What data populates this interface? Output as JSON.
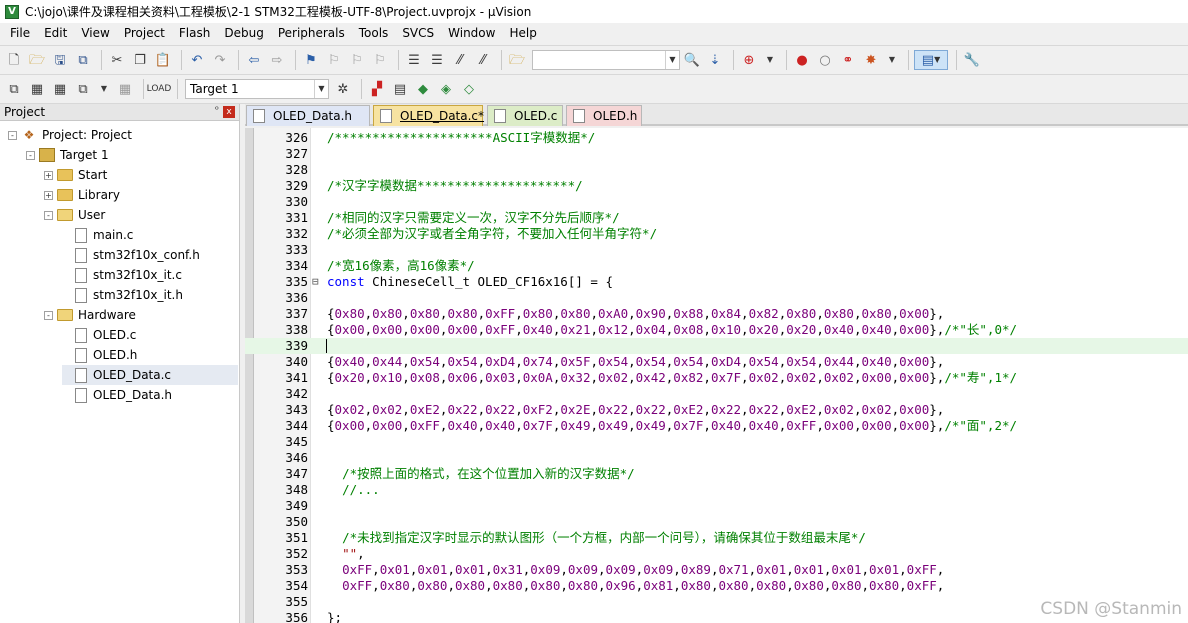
{
  "window": {
    "title": "C:\\jojo\\课件及课程相关资料\\工程模板\\2-1 STM32工程模板-UTF-8\\Project.uvprojx - µVision",
    "app_icon": "V"
  },
  "menu": [
    "File",
    "Edit",
    "View",
    "Project",
    "Flash",
    "Debug",
    "Peripherals",
    "Tools",
    "SVCS",
    "Window",
    "Help"
  ],
  "toolbar2": {
    "target": "Target 1"
  },
  "project_panel": {
    "title": "Project",
    "pin": "ᵒ",
    "close": "x",
    "tree": [
      {
        "label": "Project: Project",
        "level": 0,
        "kind": "project",
        "exp": "-"
      },
      {
        "label": "Target 1",
        "level": 1,
        "kind": "target",
        "exp": "-"
      },
      {
        "label": "Start",
        "level": 2,
        "kind": "folder",
        "exp": "+"
      },
      {
        "label": "Library",
        "level": 2,
        "kind": "folder",
        "exp": "+"
      },
      {
        "label": "User",
        "level": 2,
        "kind": "folder-open",
        "exp": "-"
      },
      {
        "label": "main.c",
        "level": 3,
        "kind": "file"
      },
      {
        "label": "stm32f10x_conf.h",
        "level": 3,
        "kind": "file"
      },
      {
        "label": "stm32f10x_it.c",
        "level": 3,
        "kind": "file"
      },
      {
        "label": "stm32f10x_it.h",
        "level": 3,
        "kind": "file"
      },
      {
        "label": "Hardware",
        "level": 2,
        "kind": "folder-open",
        "exp": "-"
      },
      {
        "label": "OLED.c",
        "level": 3,
        "kind": "file"
      },
      {
        "label": "OLED.h",
        "level": 3,
        "kind": "file"
      },
      {
        "label": "OLED_Data.c",
        "level": 3,
        "kind": "file",
        "selected": true
      },
      {
        "label": "OLED_Data.h",
        "level": 3,
        "kind": "file"
      }
    ]
  },
  "tabs": [
    {
      "label": "OLED_Data.h"
    },
    {
      "label": "OLED_Data.c*"
    },
    {
      "label": "OLED.c"
    },
    {
      "label": "OLED.h"
    }
  ],
  "code": [
    {
      "n": "326",
      "segs": [
        [
          "cmt",
          "/*********************ASCII字模数据*/"
        ]
      ]
    },
    {
      "n": "327",
      "segs": []
    },
    {
      "n": "328",
      "segs": []
    },
    {
      "n": "329",
      "segs": [
        [
          "cmt",
          "/*汉字字模数据*********************/"
        ]
      ]
    },
    {
      "n": "330",
      "segs": []
    },
    {
      "n": "331",
      "segs": [
        [
          "cmt",
          "/*相同的汉字只需要定义一次，汉字不分先后顺序*/"
        ]
      ]
    },
    {
      "n": "332",
      "segs": [
        [
          "cmt",
          "/*必须全部为汉字或者全角字符，不要加入任何半角字符*/"
        ]
      ]
    },
    {
      "n": "333",
      "segs": []
    },
    {
      "n": "334",
      "segs": [
        [
          "cmt",
          "/*宽16像素，高16像素*/"
        ]
      ]
    },
    {
      "n": "335",
      "fold": "⊟",
      "segs": [
        [
          "kw",
          "const"
        ],
        [
          "plain",
          " ChineseCell_t OLED_CF16x16[] = {"
        ]
      ]
    },
    {
      "n": "336",
      "segs": []
    },
    {
      "n": "337",
      "segs": [
        [
          "plain",
          "{"
        ],
        [
          "num",
          "0x80"
        ],
        [
          "plain",
          ","
        ],
        [
          "num",
          "0x80"
        ],
        [
          "plain",
          ","
        ],
        [
          "num",
          "0x80"
        ],
        [
          "plain",
          ","
        ],
        [
          "num",
          "0x80"
        ],
        [
          "plain",
          ","
        ],
        [
          "num",
          "0xFF"
        ],
        [
          "plain",
          ","
        ],
        [
          "num",
          "0x80"
        ],
        [
          "plain",
          ","
        ],
        [
          "num",
          "0x80"
        ],
        [
          "plain",
          ","
        ],
        [
          "num",
          "0xA0"
        ],
        [
          "plain",
          ","
        ],
        [
          "num",
          "0x90"
        ],
        [
          "plain",
          ","
        ],
        [
          "num",
          "0x88"
        ],
        [
          "plain",
          ","
        ],
        [
          "num",
          "0x84"
        ],
        [
          "plain",
          ","
        ],
        [
          "num",
          "0x82"
        ],
        [
          "plain",
          ","
        ],
        [
          "num",
          "0x80"
        ],
        [
          "plain",
          ","
        ],
        [
          "num",
          "0x80"
        ],
        [
          "plain",
          ","
        ],
        [
          "num",
          "0x80"
        ],
        [
          "plain",
          ","
        ],
        [
          "num",
          "0x00"
        ],
        [
          "plain",
          "},"
        ]
      ]
    },
    {
      "n": "338",
      "segs": [
        [
          "plain",
          "{"
        ],
        [
          "num",
          "0x00"
        ],
        [
          "plain",
          ","
        ],
        [
          "num",
          "0x00"
        ],
        [
          "plain",
          ","
        ],
        [
          "num",
          "0x00"
        ],
        [
          "plain",
          ","
        ],
        [
          "num",
          "0x00"
        ],
        [
          "plain",
          ","
        ],
        [
          "num",
          "0xFF"
        ],
        [
          "plain",
          ","
        ],
        [
          "num",
          "0x40"
        ],
        [
          "plain",
          ","
        ],
        [
          "num",
          "0x21"
        ],
        [
          "plain",
          ","
        ],
        [
          "num",
          "0x12"
        ],
        [
          "plain",
          ","
        ],
        [
          "num",
          "0x04"
        ],
        [
          "plain",
          ","
        ],
        [
          "num",
          "0x08"
        ],
        [
          "plain",
          ","
        ],
        [
          "num",
          "0x10"
        ],
        [
          "plain",
          ","
        ],
        [
          "num",
          "0x20"
        ],
        [
          "plain",
          ","
        ],
        [
          "num",
          "0x20"
        ],
        [
          "plain",
          ","
        ],
        [
          "num",
          "0x40"
        ],
        [
          "plain",
          ","
        ],
        [
          "num",
          "0x40"
        ],
        [
          "plain",
          ","
        ],
        [
          "num",
          "0x00"
        ],
        [
          "plain",
          "},"
        ],
        [
          "cmt",
          "/*\"长\",0*/"
        ]
      ]
    },
    {
      "n": "339",
      "current": true,
      "segs": []
    },
    {
      "n": "340",
      "segs": [
        [
          "plain",
          "{"
        ],
        [
          "num",
          "0x40"
        ],
        [
          "plain",
          ","
        ],
        [
          "num",
          "0x44"
        ],
        [
          "plain",
          ","
        ],
        [
          "num",
          "0x54"
        ],
        [
          "plain",
          ","
        ],
        [
          "num",
          "0x54"
        ],
        [
          "plain",
          ","
        ],
        [
          "num",
          "0xD4"
        ],
        [
          "plain",
          ","
        ],
        [
          "num",
          "0x74"
        ],
        [
          "plain",
          ","
        ],
        [
          "num",
          "0x5F"
        ],
        [
          "plain",
          ","
        ],
        [
          "num",
          "0x54"
        ],
        [
          "plain",
          ","
        ],
        [
          "num",
          "0x54"
        ],
        [
          "plain",
          ","
        ],
        [
          "num",
          "0x54"
        ],
        [
          "plain",
          ","
        ],
        [
          "num",
          "0xD4"
        ],
        [
          "plain",
          ","
        ],
        [
          "num",
          "0x54"
        ],
        [
          "plain",
          ","
        ],
        [
          "num",
          "0x54"
        ],
        [
          "plain",
          ","
        ],
        [
          "num",
          "0x44"
        ],
        [
          "plain",
          ","
        ],
        [
          "num",
          "0x40"
        ],
        [
          "plain",
          ","
        ],
        [
          "num",
          "0x00"
        ],
        [
          "plain",
          "},"
        ]
      ]
    },
    {
      "n": "341",
      "segs": [
        [
          "plain",
          "{"
        ],
        [
          "num",
          "0x20"
        ],
        [
          "plain",
          ","
        ],
        [
          "num",
          "0x10"
        ],
        [
          "plain",
          ","
        ],
        [
          "num",
          "0x08"
        ],
        [
          "plain",
          ","
        ],
        [
          "num",
          "0x06"
        ],
        [
          "plain",
          ","
        ],
        [
          "num",
          "0x03"
        ],
        [
          "plain",
          ","
        ],
        [
          "num",
          "0x0A"
        ],
        [
          "plain",
          ","
        ],
        [
          "num",
          "0x32"
        ],
        [
          "plain",
          ","
        ],
        [
          "num",
          "0x02"
        ],
        [
          "plain",
          ","
        ],
        [
          "num",
          "0x42"
        ],
        [
          "plain",
          ","
        ],
        [
          "num",
          "0x82"
        ],
        [
          "plain",
          ","
        ],
        [
          "num",
          "0x7F"
        ],
        [
          "plain",
          ","
        ],
        [
          "num",
          "0x02"
        ],
        [
          "plain",
          ","
        ],
        [
          "num",
          "0x02"
        ],
        [
          "plain",
          ","
        ],
        [
          "num",
          "0x02"
        ],
        [
          "plain",
          ","
        ],
        [
          "num",
          "0x00"
        ],
        [
          "plain",
          ","
        ],
        [
          "num",
          "0x00"
        ],
        [
          "plain",
          "},"
        ],
        [
          "cmt",
          "/*\"寿\",1*/"
        ]
      ]
    },
    {
      "n": "342",
      "segs": []
    },
    {
      "n": "343",
      "segs": [
        [
          "plain",
          "{"
        ],
        [
          "num",
          "0x02"
        ],
        [
          "plain",
          ","
        ],
        [
          "num",
          "0x02"
        ],
        [
          "plain",
          ","
        ],
        [
          "num",
          "0xE2"
        ],
        [
          "plain",
          ","
        ],
        [
          "num",
          "0x22"
        ],
        [
          "plain",
          ","
        ],
        [
          "num",
          "0x22"
        ],
        [
          "plain",
          ","
        ],
        [
          "num",
          "0xF2"
        ],
        [
          "plain",
          ","
        ],
        [
          "num",
          "0x2E"
        ],
        [
          "plain",
          ","
        ],
        [
          "num",
          "0x22"
        ],
        [
          "plain",
          ","
        ],
        [
          "num",
          "0x22"
        ],
        [
          "plain",
          ","
        ],
        [
          "num",
          "0xE2"
        ],
        [
          "plain",
          ","
        ],
        [
          "num",
          "0x22"
        ],
        [
          "plain",
          ","
        ],
        [
          "num",
          "0x22"
        ],
        [
          "plain",
          ","
        ],
        [
          "num",
          "0xE2"
        ],
        [
          "plain",
          ","
        ],
        [
          "num",
          "0x02"
        ],
        [
          "plain",
          ","
        ],
        [
          "num",
          "0x02"
        ],
        [
          "plain",
          ","
        ],
        [
          "num",
          "0x00"
        ],
        [
          "plain",
          "},"
        ]
      ]
    },
    {
      "n": "344",
      "segs": [
        [
          "plain",
          "{"
        ],
        [
          "num",
          "0x00"
        ],
        [
          "plain",
          ","
        ],
        [
          "num",
          "0x00"
        ],
        [
          "plain",
          ","
        ],
        [
          "num",
          "0xFF"
        ],
        [
          "plain",
          ","
        ],
        [
          "num",
          "0x40"
        ],
        [
          "plain",
          ","
        ],
        [
          "num",
          "0x40"
        ],
        [
          "plain",
          ","
        ],
        [
          "num",
          "0x7F"
        ],
        [
          "plain",
          ","
        ],
        [
          "num",
          "0x49"
        ],
        [
          "plain",
          ","
        ],
        [
          "num",
          "0x49"
        ],
        [
          "plain",
          ","
        ],
        [
          "num",
          "0x49"
        ],
        [
          "plain",
          ","
        ],
        [
          "num",
          "0x7F"
        ],
        [
          "plain",
          ","
        ],
        [
          "num",
          "0x40"
        ],
        [
          "plain",
          ","
        ],
        [
          "num",
          "0x40"
        ],
        [
          "plain",
          ","
        ],
        [
          "num",
          "0xFF"
        ],
        [
          "plain",
          ","
        ],
        [
          "num",
          "0x00"
        ],
        [
          "plain",
          ","
        ],
        [
          "num",
          "0x00"
        ],
        [
          "plain",
          ","
        ],
        [
          "num",
          "0x00"
        ],
        [
          "plain",
          "},"
        ],
        [
          "cmt",
          "/*\"面\",2*/"
        ]
      ]
    },
    {
      "n": "345",
      "segs": []
    },
    {
      "n": "346",
      "segs": []
    },
    {
      "n": "347",
      "segs": [
        [
          "plain",
          "  "
        ],
        [
          "cmt",
          "/*按照上面的格式，在这个位置加入新的汉字数据*/"
        ]
      ]
    },
    {
      "n": "348",
      "segs": [
        [
          "plain",
          "  "
        ],
        [
          "cmt",
          "//..."
        ]
      ]
    },
    {
      "n": "349",
      "segs": []
    },
    {
      "n": "350",
      "segs": []
    },
    {
      "n": "351",
      "segs": [
        [
          "plain",
          "  "
        ],
        [
          "cmt",
          "/*未找到指定汉字时显示的默认图形（一个方框，内部一个问号），请确保其位于数组最末尾*/"
        ]
      ]
    },
    {
      "n": "352",
      "segs": [
        [
          "plain",
          "  "
        ],
        [
          "str",
          "\"\""
        ],
        [
          "plain",
          ","
        ]
      ]
    },
    {
      "n": "353",
      "segs": [
        [
          "plain",
          "  "
        ],
        [
          "num",
          "0xFF"
        ],
        [
          "plain",
          ","
        ],
        [
          "num",
          "0x01"
        ],
        [
          "plain",
          ","
        ],
        [
          "num",
          "0x01"
        ],
        [
          "plain",
          ","
        ],
        [
          "num",
          "0x01"
        ],
        [
          "plain",
          ","
        ],
        [
          "num",
          "0x31"
        ],
        [
          "plain",
          ","
        ],
        [
          "num",
          "0x09"
        ],
        [
          "plain",
          ","
        ],
        [
          "num",
          "0x09"
        ],
        [
          "plain",
          ","
        ],
        [
          "num",
          "0x09"
        ],
        [
          "plain",
          ","
        ],
        [
          "num",
          "0x09"
        ],
        [
          "plain",
          ","
        ],
        [
          "num",
          "0x89"
        ],
        [
          "plain",
          ","
        ],
        [
          "num",
          "0x71"
        ],
        [
          "plain",
          ","
        ],
        [
          "num",
          "0x01"
        ],
        [
          "plain",
          ","
        ],
        [
          "num",
          "0x01"
        ],
        [
          "plain",
          ","
        ],
        [
          "num",
          "0x01"
        ],
        [
          "plain",
          ","
        ],
        [
          "num",
          "0x01"
        ],
        [
          "plain",
          ","
        ],
        [
          "num",
          "0xFF"
        ],
        [
          "plain",
          ","
        ]
      ]
    },
    {
      "n": "354",
      "segs": [
        [
          "plain",
          "  "
        ],
        [
          "num",
          "0xFF"
        ],
        [
          "plain",
          ","
        ],
        [
          "num",
          "0x80"
        ],
        [
          "plain",
          ","
        ],
        [
          "num",
          "0x80"
        ],
        [
          "plain",
          ","
        ],
        [
          "num",
          "0x80"
        ],
        [
          "plain",
          ","
        ],
        [
          "num",
          "0x80"
        ],
        [
          "plain",
          ","
        ],
        [
          "num",
          "0x80"
        ],
        [
          "plain",
          ","
        ],
        [
          "num",
          "0x80"
        ],
        [
          "plain",
          ","
        ],
        [
          "num",
          "0x96"
        ],
        [
          "plain",
          ","
        ],
        [
          "num",
          "0x81"
        ],
        [
          "plain",
          ","
        ],
        [
          "num",
          "0x80"
        ],
        [
          "plain",
          ","
        ],
        [
          "num",
          "0x80"
        ],
        [
          "plain",
          ","
        ],
        [
          "num",
          "0x80"
        ],
        [
          "plain",
          ","
        ],
        [
          "num",
          "0x80"
        ],
        [
          "plain",
          ","
        ],
        [
          "num",
          "0x80"
        ],
        [
          "plain",
          ","
        ],
        [
          "num",
          "0x80"
        ],
        [
          "plain",
          ","
        ],
        [
          "num",
          "0xFF"
        ],
        [
          "plain",
          ","
        ]
      ]
    },
    {
      "n": "355",
      "segs": []
    },
    {
      "n": "356",
      "segs": [
        [
          "plain",
          "};"
        ]
      ]
    }
  ],
  "watermark": "CSDN @Stanmin"
}
